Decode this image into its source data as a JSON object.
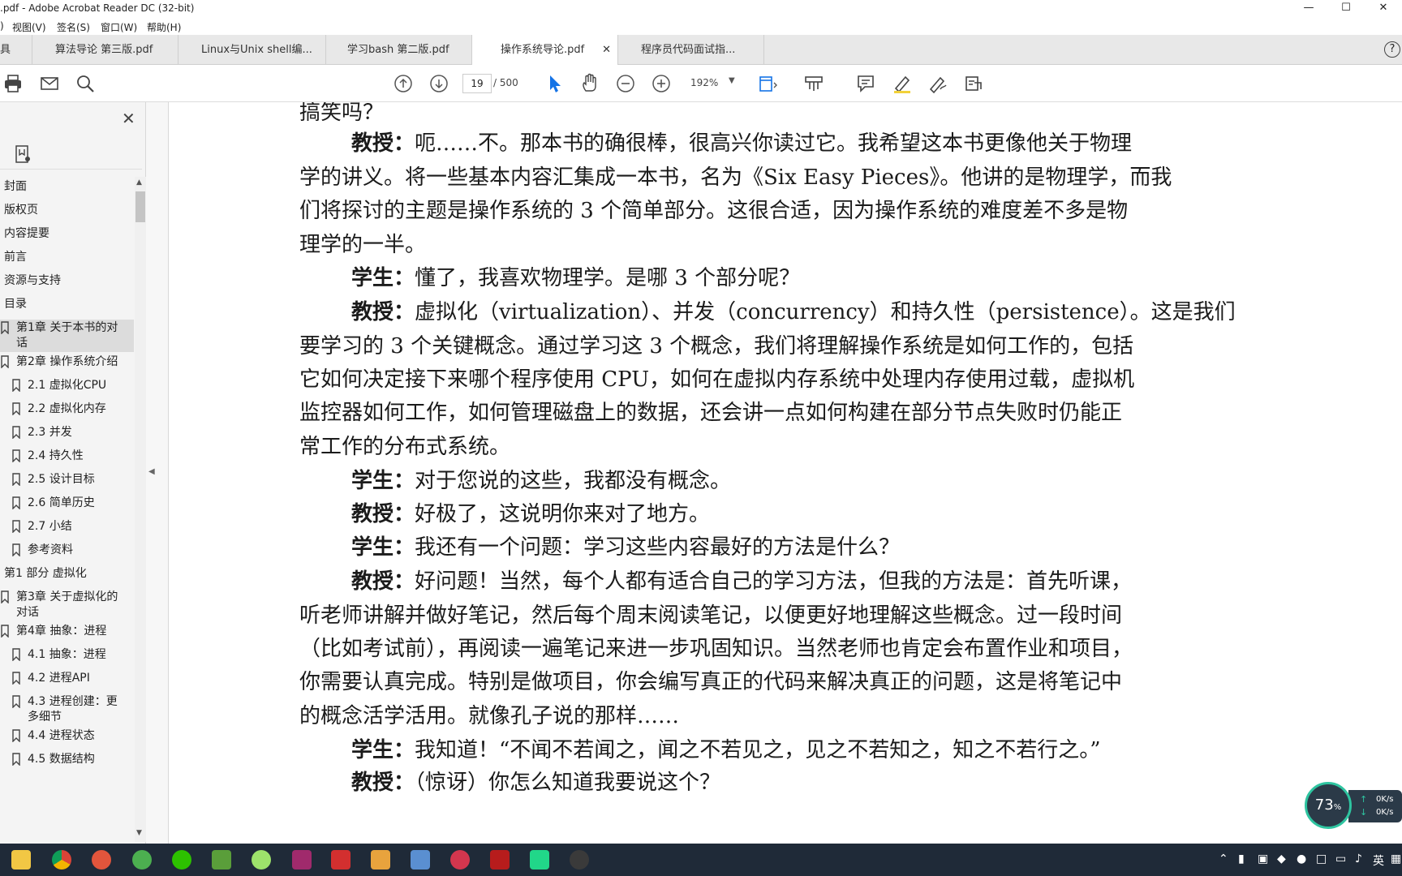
{
  "window": {
    "title": ".pdf - Adobe Acrobat Reader DC (32-bit)"
  },
  "menu": [
    "视图(V)",
    "签名(S)",
    "窗口(W)",
    "帮助(H)"
  ],
  "tabs": [
    {
      "label": "具"
    },
    {
      "label": "算法导论 第三版.pdf"
    },
    {
      "label": "Linux与Unix shell编..."
    },
    {
      "label": "学习bash 第二版.pdf"
    },
    {
      "label": "操作系统导论.pdf",
      "active": true
    },
    {
      "label": "程序员代码面试指..."
    }
  ],
  "toolbar": {
    "page_current": "19",
    "page_total": "/ 500",
    "zoom": "192%"
  },
  "bookmarks": [
    {
      "label": "封面",
      "level": 0
    },
    {
      "label": "版权页",
      "level": 0
    },
    {
      "label": "内容提要",
      "level": 0
    },
    {
      "label": "前言",
      "level": 0
    },
    {
      "label": "资源与支持",
      "level": 0
    },
    {
      "label": "目录",
      "level": 0
    },
    {
      "label": "第1章 关于本书的对",
      "label2": "话",
      "level": 1,
      "selected": true
    },
    {
      "label": "第2章 操作系统介绍",
      "level": 1
    },
    {
      "label": "2.1 虚拟化CPU",
      "level": 2
    },
    {
      "label": "2.2 虚拟化内存",
      "level": 2
    },
    {
      "label": "2.3 并发",
      "level": 2
    },
    {
      "label": "2.4 持久性",
      "level": 2
    },
    {
      "label": "2.5 设计目标",
      "level": 2
    },
    {
      "label": "2.6 简单历史",
      "level": 2
    },
    {
      "label": "2.7 小结",
      "level": 2
    },
    {
      "label": "参考资料",
      "level": 2
    },
    {
      "label": "第1 部分 虚拟化",
      "level": 0
    },
    {
      "label": "第3章 关于虚拟化的",
      "label2": "对话",
      "level": 1
    },
    {
      "label": "第4章 抽象：进程",
      "level": 1
    },
    {
      "label": "4.1 抽象：进程",
      "level": 2
    },
    {
      "label": "4.2 进程API",
      "level": 2
    },
    {
      "label": "4.3 进程创建：更",
      "label2": "多细节",
      "level": 2
    },
    {
      "label": "4.4 进程状态",
      "level": 2
    },
    {
      "label": "4.5 数据结构",
      "level": 2
    }
  ],
  "document": {
    "lines": [
      {
        "speaker": "",
        "text": "搞笑吗？",
        "indent": false
      },
      {
        "speaker": "教授：",
        "text": "呃……不。那本书的确很棒，很高兴你读过它。我希望这本书更像他关于物理",
        "indent": true
      },
      {
        "speaker": "",
        "text": "学的讲义。将一些基本内容汇集成一本书，名为《Six Easy Pieces》。他讲的是物理学，而我",
        "indent": false
      },
      {
        "speaker": "",
        "text": "们将探讨的主题是操作系统的 3 个简单部分。这很合适，因为操作系统的难度差不多是物",
        "indent": false
      },
      {
        "speaker": "",
        "text": "理学的一半。",
        "indent": false
      },
      {
        "speaker": "学生：",
        "text": "懂了，我喜欢物理学。是哪 3 个部分呢？",
        "indent": true
      },
      {
        "speaker": "教授：",
        "text": "虚拟化（virtualization）、并发（concurrency）和持久性（persistence）。这是我们",
        "indent": true
      },
      {
        "speaker": "",
        "text": "要学习的 3 个关键概念。通过学习这 3 个概念，我们将理解操作系统是如何工作的，包括",
        "indent": false
      },
      {
        "speaker": "",
        "text": "它如何决定接下来哪个程序使用 CPU，如何在虚拟内存系统中处理内存使用过载，虚拟机",
        "indent": false
      },
      {
        "speaker": "",
        "text": "监控器如何工作，如何管理磁盘上的数据，还会讲一点如何构建在部分节点失败时仍能正",
        "indent": false
      },
      {
        "speaker": "",
        "text": "常工作的分布式系统。",
        "indent": false
      },
      {
        "speaker": "学生：",
        "text": "对于您说的这些，我都没有概念。",
        "indent": true
      },
      {
        "speaker": "教授：",
        "text": "好极了，这说明你来对了地方。",
        "indent": true
      },
      {
        "speaker": "学生：",
        "text": "我还有一个问题：学习这些内容最好的方法是什么？",
        "indent": true
      },
      {
        "speaker": "教授：",
        "text": "好问题！当然，每个人都有适合自己的学习方法，但我的方法是：首先听课，",
        "indent": true
      },
      {
        "speaker": "",
        "text": "听老师讲解并做好笔记，然后每个周末阅读笔记，以便更好地理解这些概念。过一段时间",
        "indent": false
      },
      {
        "speaker": "",
        "text": "（比如考试前），再阅读一遍笔记来进一步巩固知识。当然老师也肯定会布置作业和项目，",
        "indent": false
      },
      {
        "speaker": "",
        "text": "你需要认真完成。特别是做项目，你会编写真正的代码来解决真正的问题，这是将笔记中",
        "indent": false
      },
      {
        "speaker": "",
        "text": "的概念活学活用。就像孔子说的那样……",
        "indent": false
      },
      {
        "speaker": "学生：",
        "text": "我知道！“不闻不若闻之，闻之不若见之，见之不若知之，知之不若行之。”",
        "indent": true
      },
      {
        "speaker": "教授：",
        "text": "（惊讶）你怎么知道我要说这个？",
        "indent": true
      }
    ]
  },
  "speed_widget": {
    "percent": "73",
    "unit": "%",
    "up": "0K/s",
    "down": "0K/s"
  },
  "tray": {
    "ime": "英"
  },
  "colors": {
    "taskbar": "#1f2a38",
    "accent_blue": "#1473e6"
  }
}
